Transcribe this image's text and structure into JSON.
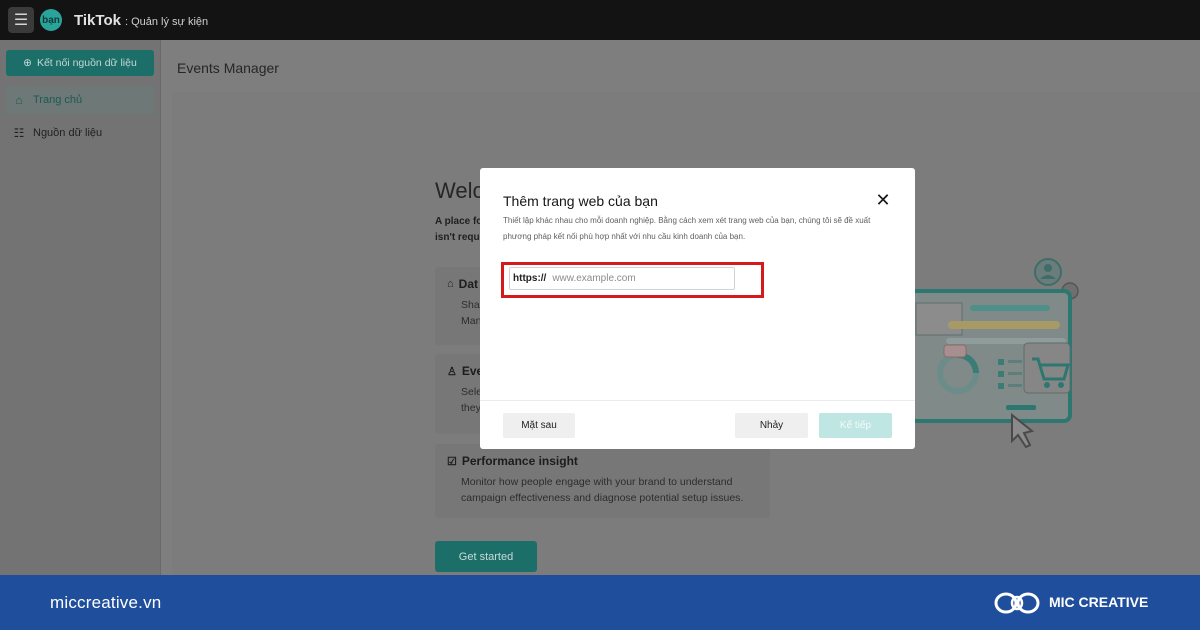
{
  "header": {
    "avatar_text": "bạn",
    "brand": "TikTok",
    "brand_sub": ": Quản lý sự kiện"
  },
  "sidebar": {
    "connect_label": "Kết nối nguồn dữ liệu",
    "items": [
      {
        "label": "Trang chủ",
        "icon": "home-icon",
        "active": true
      },
      {
        "label": "Nguồn dữ liệu",
        "icon": "list-icon",
        "active": false
      }
    ]
  },
  "main": {
    "title": "Events Manager",
    "welcome_title": "Welc",
    "welcome_desc_line1": "A place fo",
    "welcome_desc_line2": "isn't requ",
    "cards": [
      {
        "title": "Dat",
        "text": "Sha\nMan"
      },
      {
        "title": "Eve",
        "text": "Sele\nthey"
      },
      {
        "title": "Performance insight",
        "text": "Monitor how people engage with your brand to understand campaign effectiveness and diagnose potential setup issues."
      }
    ],
    "get_started": "Get started"
  },
  "modal": {
    "title": "Thêm trang web của bạn",
    "description": "Thiết lập khác nhau cho mỗi doanh nghiệp. Bằng cách xem xét trang web của bạn, chúng tôi sẽ đề xuất phương pháp kết nối phù hợp nhất với nhu cầu kinh doanh của bạn.",
    "url_prefix": "https://",
    "url_placeholder": "www.example.com",
    "back_label": "Mặt sau",
    "skip_label": "Nhảy",
    "next_label": "Kế tiếp"
  },
  "footer": {
    "site": "miccreative.vn",
    "brand": "MIC CREATIVE"
  },
  "colors": {
    "accent": "#1c6f69",
    "highlight": "#d41b1b",
    "footer": "#1f4f9c"
  }
}
